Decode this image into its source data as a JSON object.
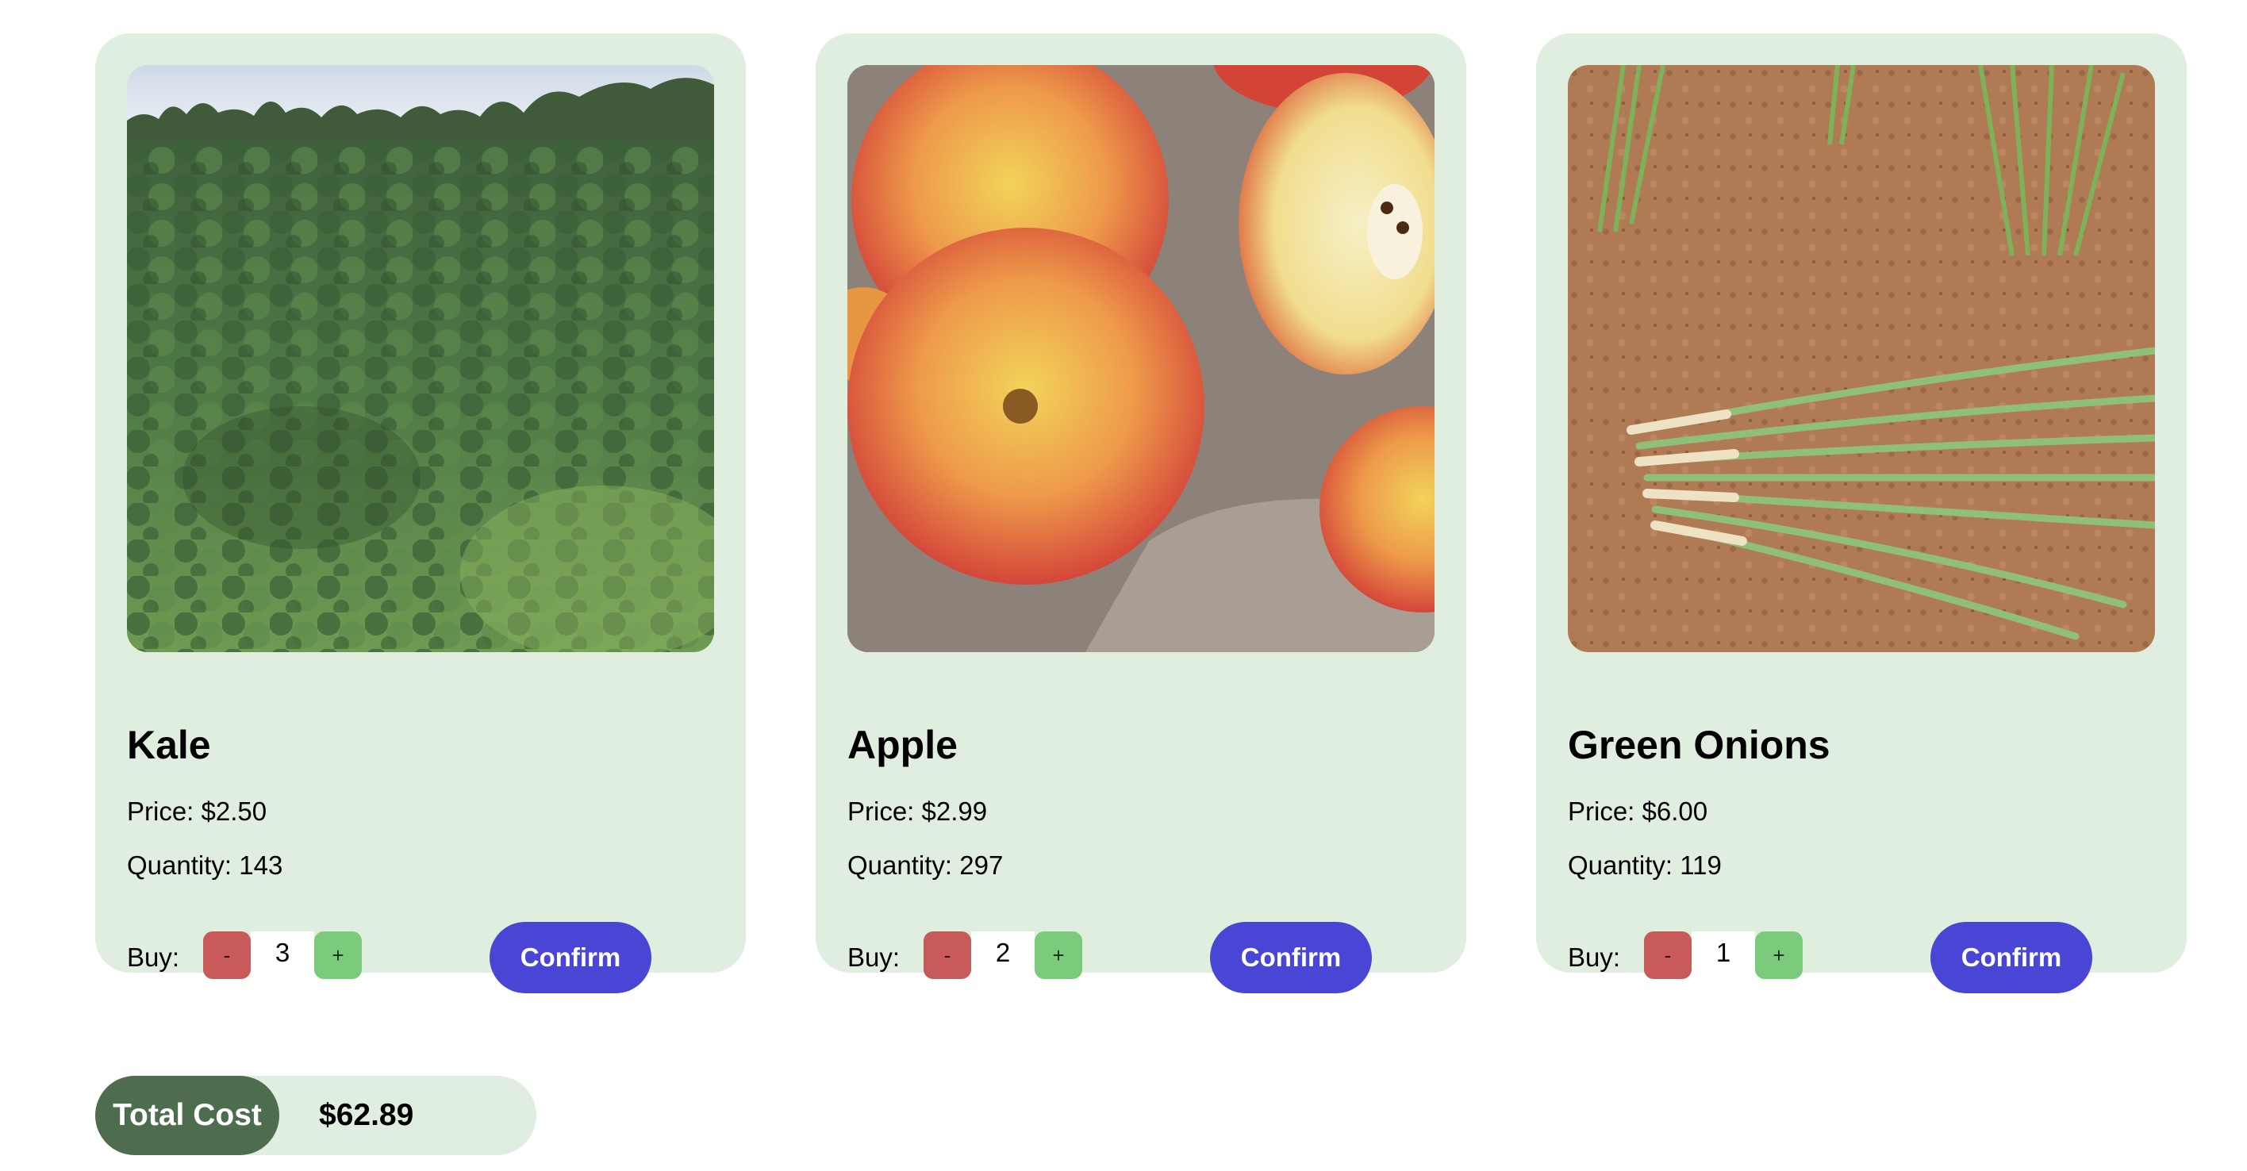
{
  "products": [
    {
      "name": "Kale",
      "price_text": "Price: $2.50",
      "quantity_text": "Quantity: 143",
      "buy_label": "Buy:",
      "minus_label": "-",
      "count": "3",
      "plus_label": "+",
      "confirm_label": "Confirm",
      "image": "kale-field-photo"
    },
    {
      "name": "Apple",
      "price_text": "Price: $2.99",
      "quantity_text": "Quantity: 297",
      "buy_label": "Buy:",
      "minus_label": "-",
      "count": "2",
      "plus_label": "+",
      "confirm_label": "Confirm",
      "image": "apples-photo"
    },
    {
      "name": "Green Onions",
      "price_text": "Price: $6.00",
      "quantity_text": "Quantity: 119",
      "buy_label": "Buy:",
      "minus_label": "-",
      "count": "1",
      "plus_label": "+",
      "confirm_label": "Confirm",
      "image": "green-onions-photo"
    }
  ],
  "total": {
    "label": "Total Cost",
    "value": "$62.89"
  },
  "colors": {
    "card_bg": "#e0eedf",
    "confirm": "#4a46d5",
    "minus": "#c85a5a",
    "plus": "#7ccb7d",
    "total_label_bg": "#4e6d4e"
  }
}
